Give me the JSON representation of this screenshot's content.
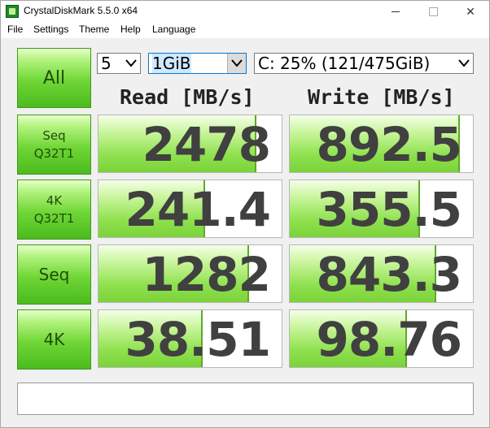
{
  "window": {
    "title": "CrystalDiskMark 5.5.0 x64"
  },
  "menu": [
    "File",
    "Settings",
    "Theme",
    "Help",
    "Language"
  ],
  "controls": {
    "all_label": "All",
    "count": "5",
    "size": "1GiB",
    "drive": "C: 25% (121/475GiB)"
  },
  "headers": {
    "read": "Read [MB/s]",
    "write": "Write [MB/s]"
  },
  "tests": [
    {
      "label_line1": "Seq",
      "label_line2": "Q32T1",
      "read": "2478",
      "write": "892.5",
      "read_fill": 0.86,
      "write_fill": 0.93
    },
    {
      "label_line1": "4K",
      "label_line2": "Q32T1",
      "read": "241.4",
      "write": "355.5",
      "read_fill": 0.58,
      "write_fill": 0.71
    },
    {
      "label_line1": "Seq",
      "label_line2": "",
      "read": "1282",
      "write": "843.3",
      "read_fill": 0.82,
      "write_fill": 0.8
    },
    {
      "label_line1": "4K",
      "label_line2": "",
      "read": "38.51",
      "write": "98.76",
      "read_fill": 0.57,
      "write_fill": 0.64
    }
  ],
  "comment": "",
  "colors": {
    "accent_green": "#6fd635",
    "bar_green": "#8fe14e",
    "text": "#404040"
  }
}
